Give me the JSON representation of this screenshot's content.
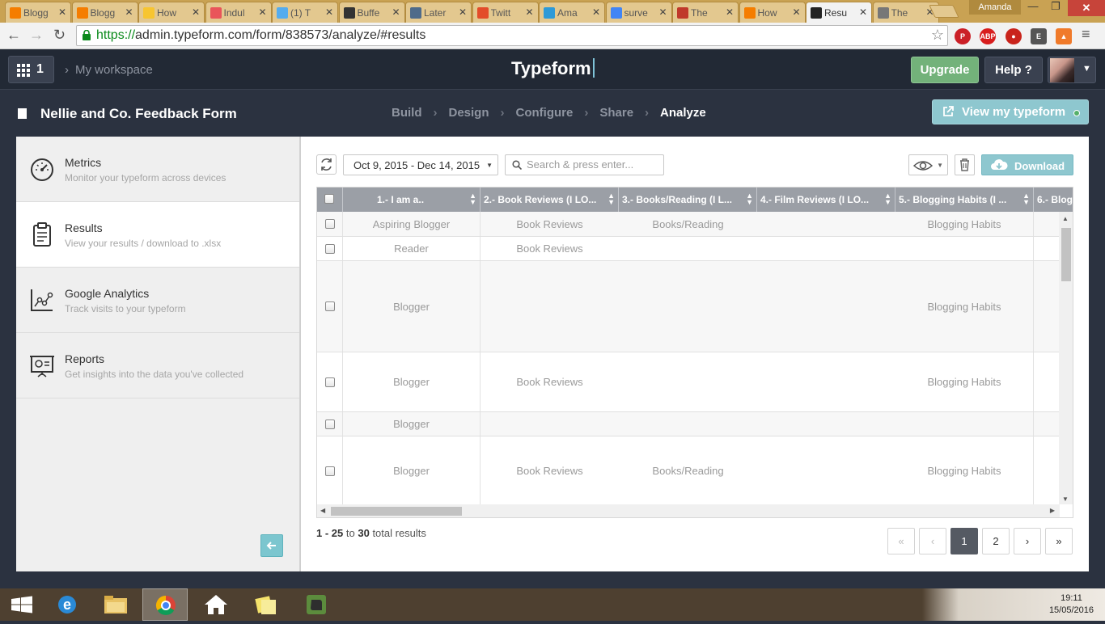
{
  "browser": {
    "tabs": [
      {
        "label": "Blogg",
        "color": "#f57d00"
      },
      {
        "label": "Blogg",
        "color": "#f57d00"
      },
      {
        "label": "How",
        "color": "#f7c531"
      },
      {
        "label": "Indul",
        "color": "#e9555a"
      },
      {
        "label": "(1) T",
        "color": "#55acee"
      },
      {
        "label": "Buffe",
        "color": "#333333"
      },
      {
        "label": "Later",
        "color": "#4e6b8a"
      },
      {
        "label": "Twitt",
        "color": "#e34c2a"
      },
      {
        "label": "Ama",
        "color": "#2d9ad8"
      },
      {
        "label": "surve",
        "color": "#4285f4"
      },
      {
        "label": "The",
        "color": "#c0392b"
      },
      {
        "label": "How",
        "color": "#f57d00"
      },
      {
        "label": "Resu",
        "color": "#222222"
      },
      {
        "label": "The",
        "color": "#777777"
      }
    ],
    "user": "Amanda",
    "url_scheme": "https://",
    "url_rest": "admin.typeform.com/form/838573/analyze/#results"
  },
  "topbar": {
    "workspace_count": "1",
    "workspace_label": "My workspace",
    "logo": "Typeform",
    "upgrade_label": "Upgrade",
    "help_label": "Help ?"
  },
  "formbar": {
    "title": "Nellie and Co. Feedback Form",
    "steps": [
      "Build",
      "Design",
      "Configure",
      "Share",
      "Analyze"
    ],
    "view_label": "View my typeform"
  },
  "sidebar": {
    "items": [
      {
        "title": "Metrics",
        "subtitle": "Monitor your typeform across devices",
        "icon": "gauge-icon"
      },
      {
        "title": "Results",
        "subtitle": "View your results / download to .xlsx",
        "icon": "clipboard-icon"
      },
      {
        "title": "Google Analytics",
        "subtitle": "Track visits to your typeform",
        "icon": "analytics-icon"
      },
      {
        "title": "Reports",
        "subtitle": "Get insights into the data you've collected",
        "icon": "presentation-icon"
      }
    ]
  },
  "toolbar": {
    "date_range": "Oct 9, 2015 - Dec 14, 2015",
    "search_placeholder": "Search & press enter...",
    "download_label": "Download"
  },
  "table": {
    "columns": [
      "1.- I am a..",
      "2.- Book Reviews (I LO...",
      "3.- Books/Reading (I L...",
      "4.- Film Reviews (I LO...",
      "5.- Blogging Habits (I ...",
      "6.- Blog"
    ],
    "rows": [
      [
        "Aspiring Blogger",
        "Book Reviews",
        "Books/Reading",
        "",
        "Blogging Habits"
      ],
      [
        "Reader",
        "Book Reviews",
        "",
        "",
        ""
      ],
      [
        "Blogger",
        "",
        "",
        "",
        "Blogging Habits"
      ],
      [
        "Blogger",
        "Book Reviews",
        "",
        "",
        "Blogging Habits"
      ],
      [
        "Blogger",
        "",
        "",
        "",
        ""
      ],
      [
        "Blogger",
        "Book Reviews",
        "Books/Reading",
        "",
        "Blogging Habits"
      ]
    ]
  },
  "footer": {
    "range": "1 - 25",
    "to": "to",
    "total": "30",
    "suffix": "total results",
    "pages": [
      "1",
      "2"
    ],
    "current_page": "1"
  },
  "taskbar": {
    "time": "19:11",
    "date": "15/05/2016"
  }
}
